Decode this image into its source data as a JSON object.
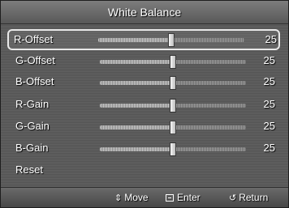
{
  "title": "White Balance",
  "items": [
    {
      "label": "R-Offset",
      "value": "25",
      "level": 0.5,
      "selected": true
    },
    {
      "label": "G-Offset",
      "value": "25",
      "level": 0.5,
      "selected": false
    },
    {
      "label": "B-Offset",
      "value": "25",
      "level": 0.5,
      "selected": false
    },
    {
      "label": "R-Gain",
      "value": "25",
      "level": 0.5,
      "selected": false
    },
    {
      "label": "G-Gain",
      "value": "25",
      "level": 0.5,
      "selected": false
    },
    {
      "label": "B-Gain",
      "value": "25",
      "level": 0.5,
      "selected": false
    }
  ],
  "reset_label": "Reset",
  "hints": {
    "move": "Move",
    "enter": "Enter",
    "return": "Return"
  },
  "icons": {
    "move": "up-down-arrow-icon",
    "enter": "enter-icon",
    "return": "return-icon"
  },
  "colors": {
    "panel": "#5c5c5c",
    "text": "#ffffff",
    "selection_border": "#e8e8e8"
  }
}
